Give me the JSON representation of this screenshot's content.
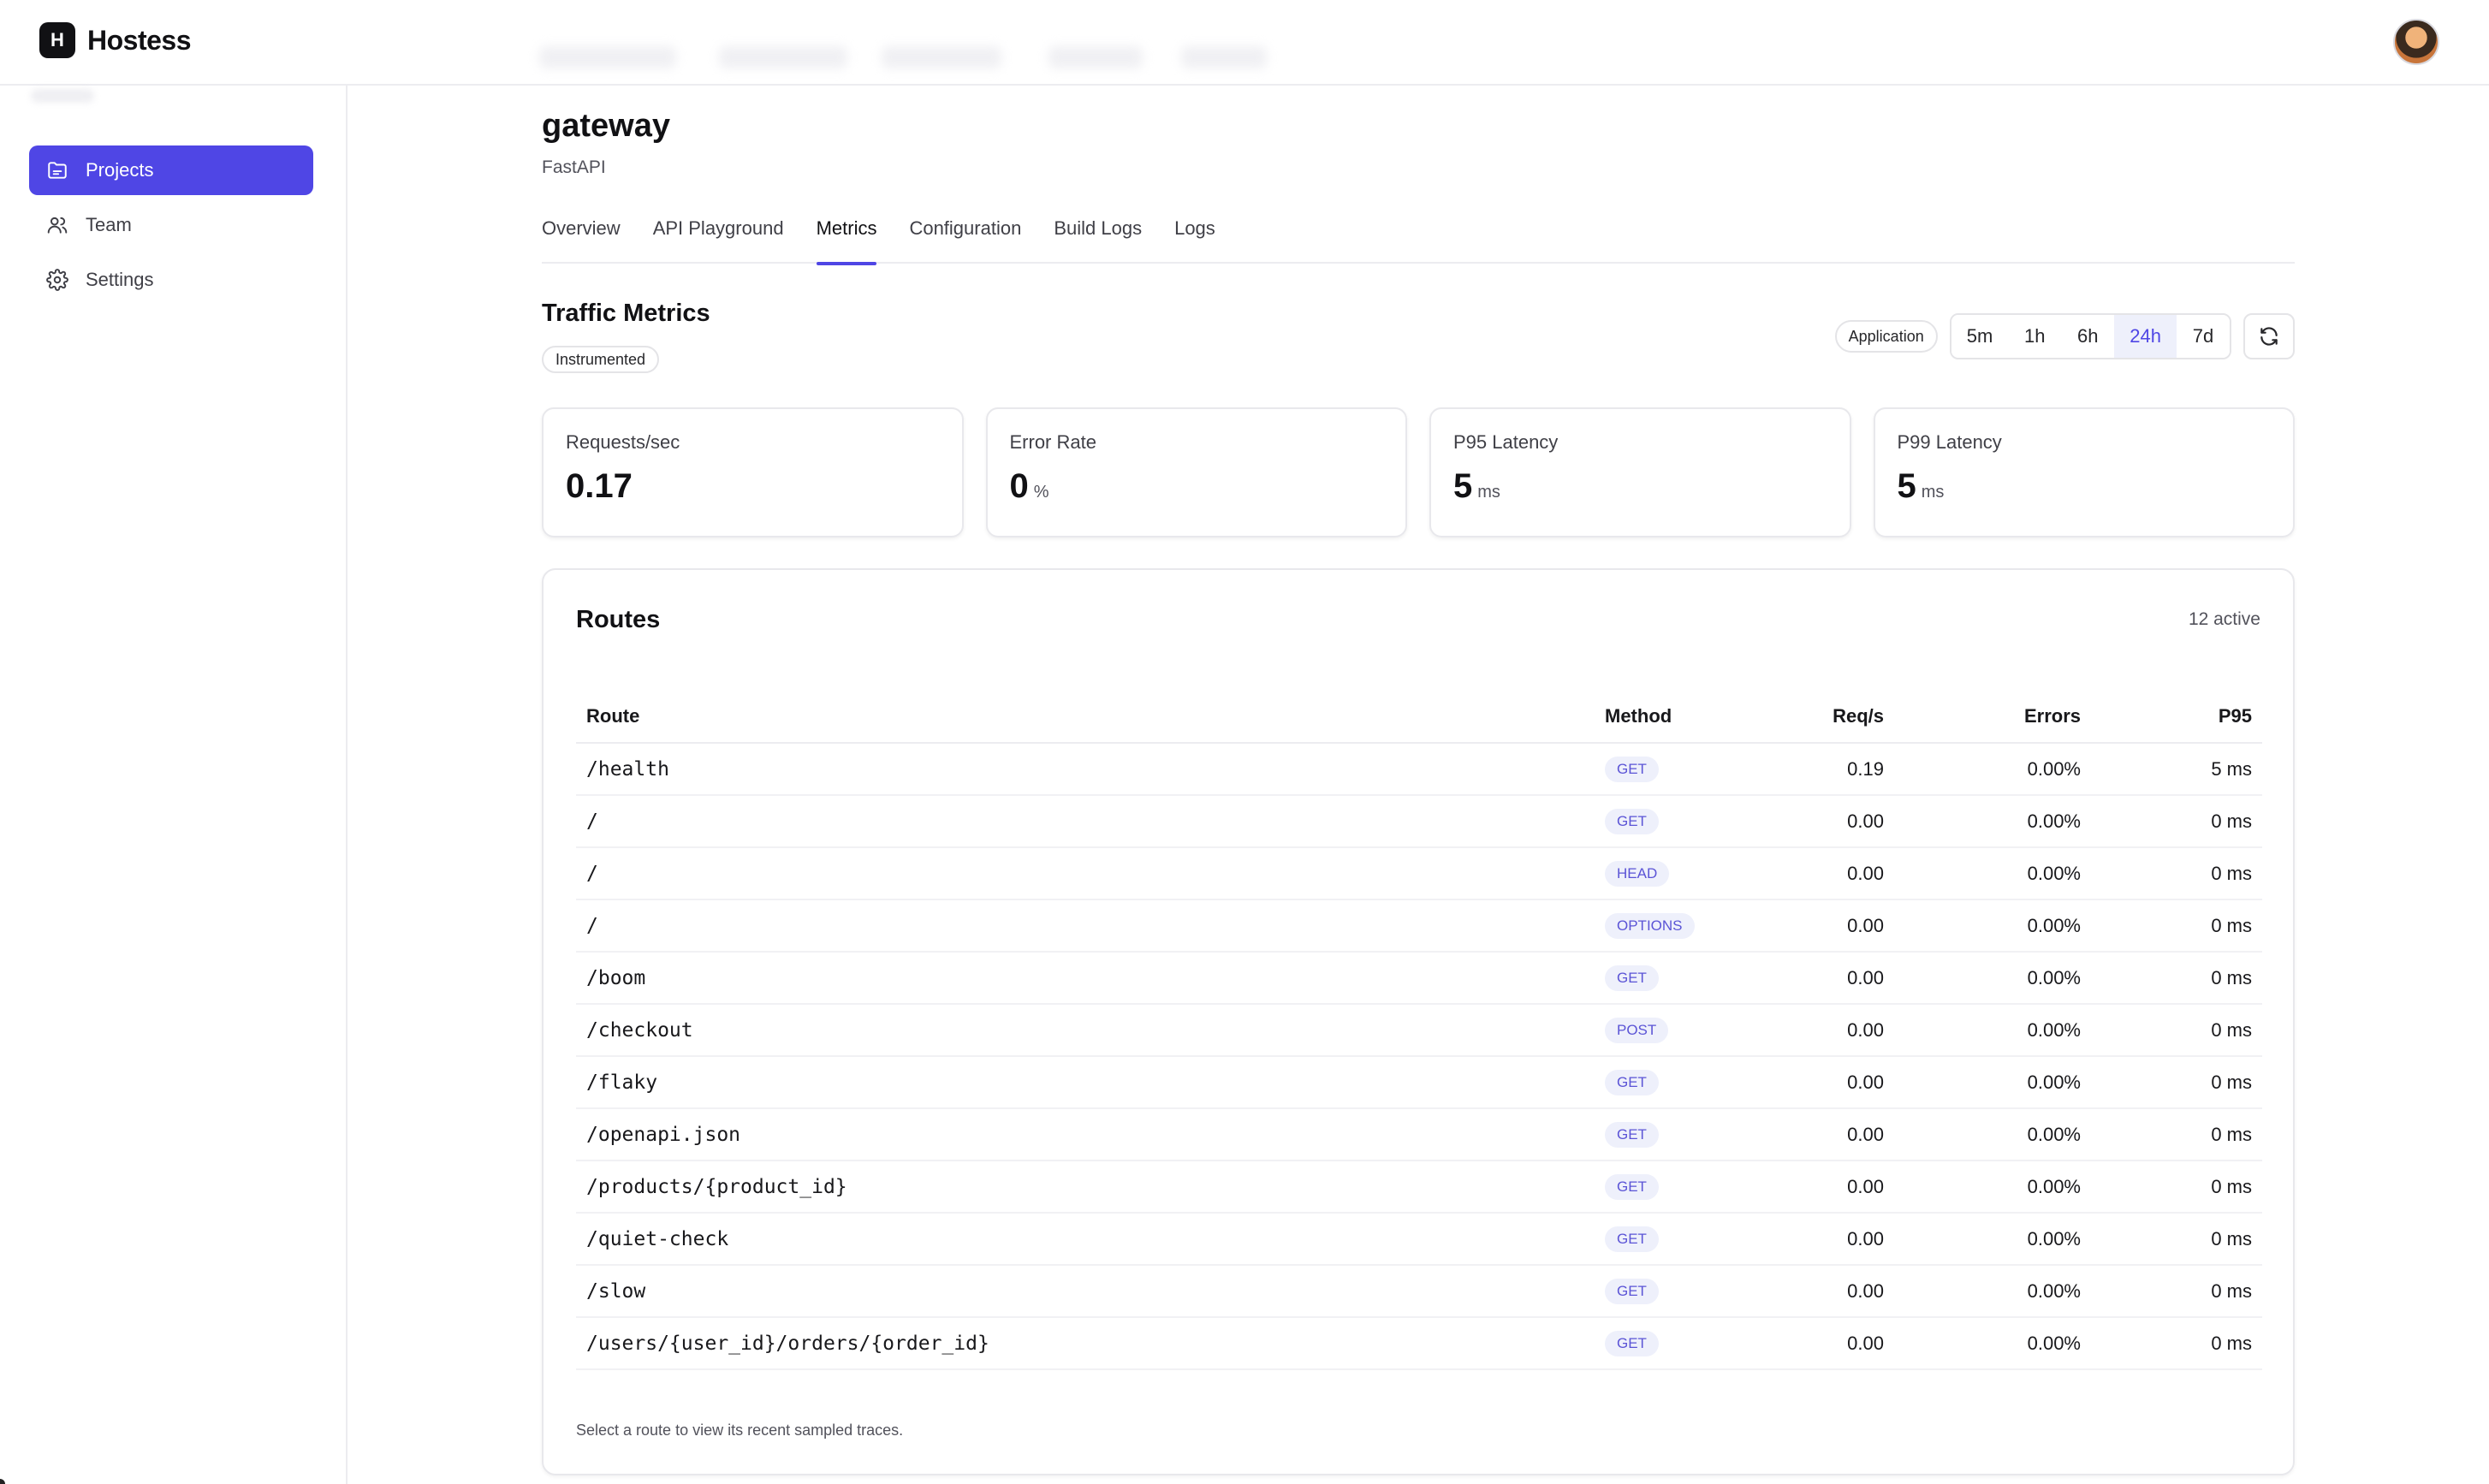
{
  "brand": {
    "logo_letter": "H",
    "name": "Hostess"
  },
  "sidebar": {
    "items": [
      {
        "label": "Projects",
        "icon": "folder-icon",
        "active": true
      },
      {
        "label": "Team",
        "icon": "users-icon",
        "active": false
      },
      {
        "label": "Settings",
        "icon": "gear-icon",
        "active": false
      }
    ]
  },
  "page": {
    "title": "gateway",
    "subtitle": "FastAPI"
  },
  "tabs": [
    "Overview",
    "API Playground",
    "Metrics",
    "Configuration",
    "Build Logs",
    "Logs"
  ],
  "active_tab": "Metrics",
  "traffic": {
    "title": "Traffic Metrics",
    "badge": "Instrumented",
    "source_pill": "Application",
    "ranges": [
      "5m",
      "1h",
      "6h",
      "24h",
      "7d"
    ],
    "active_range": "24h"
  },
  "cards": [
    {
      "label": "Requests/sec",
      "value": "0.17",
      "unit": ""
    },
    {
      "label": "Error Rate",
      "value": "0",
      "unit": "%"
    },
    {
      "label": "P95 Latency",
      "value": "5",
      "unit": "ms"
    },
    {
      "label": "P99 Latency",
      "value": "5",
      "unit": "ms"
    }
  ],
  "routes": {
    "title": "Routes",
    "count": "12 active",
    "columns": [
      "Route",
      "Method",
      "Req/s",
      "Errors",
      "P95"
    ],
    "rows": [
      [
        "/health",
        "GET",
        "0.19",
        "0.00%",
        "5 ms"
      ],
      [
        "/",
        "GET",
        "0.00",
        "0.00%",
        "0 ms"
      ],
      [
        "/",
        "HEAD",
        "0.00",
        "0.00%",
        "0 ms"
      ],
      [
        "/",
        "OPTIONS",
        "0.00",
        "0.00%",
        "0 ms"
      ],
      [
        "/boom",
        "GET",
        "0.00",
        "0.00%",
        "0 ms"
      ],
      [
        "/checkout",
        "POST",
        "0.00",
        "0.00%",
        "0 ms"
      ],
      [
        "/flaky",
        "GET",
        "0.00",
        "0.00%",
        "0 ms"
      ],
      [
        "/openapi.json",
        "GET",
        "0.00",
        "0.00%",
        "0 ms"
      ],
      [
        "/products/{product_id}",
        "GET",
        "0.00",
        "0.00%",
        "0 ms"
      ],
      [
        "/quiet-check",
        "GET",
        "0.00",
        "0.00%",
        "0 ms"
      ],
      [
        "/slow",
        "GET",
        "0.00",
        "0.00%",
        "0 ms"
      ],
      [
        "/users/{user_id}/orders/{order_id}",
        "GET",
        "0.00",
        "0.00%",
        "0 ms"
      ]
    ],
    "note": "Select a route to view its recent sampled traces."
  },
  "colors": {
    "accent": "#4f46e5",
    "method_bg": "#eef0fb",
    "method_text": "#5b54d6"
  }
}
